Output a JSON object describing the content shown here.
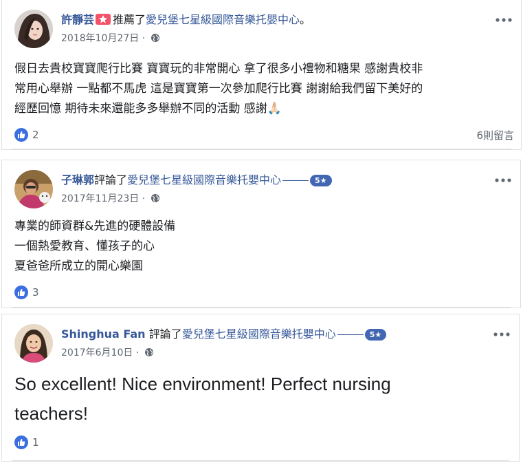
{
  "posts": [
    {
      "author": "許靜芸",
      "action": "推薦了",
      "page_name": "愛兒堡七星級國際音樂托嬰中心",
      "trailing": "。",
      "date": "2018年10月27日",
      "date_sep": "·",
      "body_lines": [
        "假日去貴校寶寶爬行比賽 寶寶玩的非常開心 拿了很多小禮物和糖果 感謝貴校非",
        "常用心舉辦 一點都不馬虎 這是寶寶第一次參加爬行比賽 謝謝給我們留下美好的",
        "經歷回憶 期待未來還能多多舉辦不同的活動 感謝🙏🏻"
      ],
      "likes": "2",
      "comments": "6則留言",
      "badge": "recommend-star-icon"
    },
    {
      "author": "子琳郭",
      "action": "評論了",
      "page_name": "愛兒堡七星級國際音樂托嬰中心",
      "rating": "5★",
      "date": "2017年11月23日",
      "date_sep": "·",
      "body_lines": [
        "專業的師資群&先進的硬體設備",
        "一個熱愛教育、懂孩子的心",
        "夏爸爸所成立的開心樂園"
      ],
      "likes": "3"
    },
    {
      "author": "Shinghua Fan",
      "action": "評論了",
      "page_name": "愛兒堡七星級國際音樂托嬰中心",
      "rating": "5★",
      "date": "2017年6月10日",
      "date_sep": "·",
      "body_lines": [
        "So excellent! Nice environment! Perfect nursing",
        "teachers!"
      ],
      "likes": "1"
    }
  ],
  "icons": {
    "more": "more-options-icon",
    "privacy": "globe-icon",
    "like": "like-thumb-icon"
  },
  "colors": {
    "link": "#365899",
    "meta": "#606770",
    "like_blue": "#3b6fe0",
    "badge_pink": "#f35369",
    "rating_pill": "#4267b2"
  }
}
